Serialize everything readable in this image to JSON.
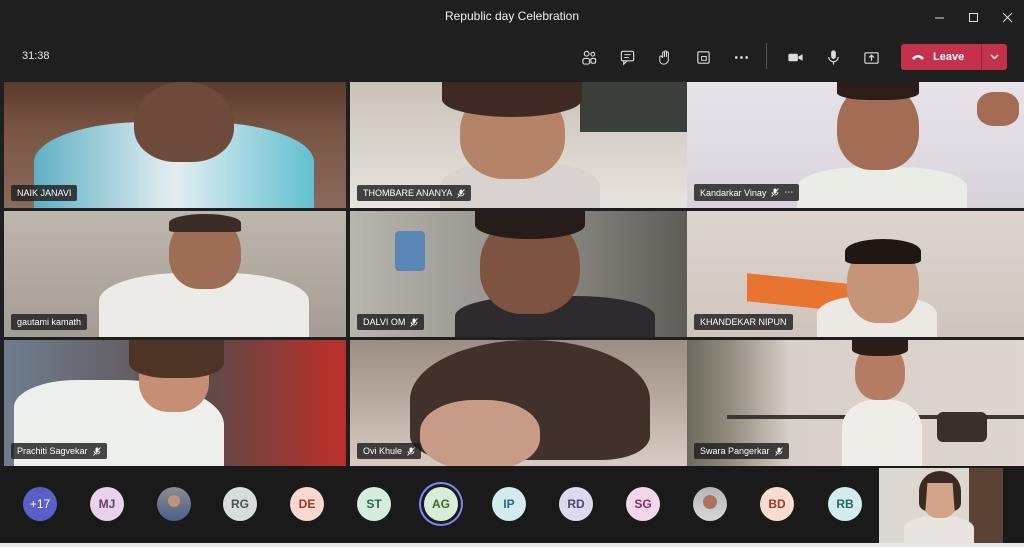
{
  "window": {
    "title": "Republic day Celebration"
  },
  "toolbar": {
    "timer": "31:38",
    "leave_label": "Leave"
  },
  "tiles": [
    {
      "name": "NAIK JANAVI",
      "muted": false,
      "more": false
    },
    {
      "name": "THOMBARE ANANYA",
      "muted": true,
      "more": false
    },
    {
      "name": "Kandarkar Vinay",
      "muted": true,
      "more": true
    },
    {
      "name": "gautami kamath",
      "muted": false,
      "more": false
    },
    {
      "name": "DALVI OM",
      "muted": true,
      "more": false
    },
    {
      "name": "KHANDEKAR NIPUN",
      "muted": false,
      "more": false
    },
    {
      "name": "Prachiti Sagvekar",
      "muted": true,
      "more": false
    },
    {
      "name": "Ovi Khule",
      "muted": true,
      "more": false
    },
    {
      "name": "Swara Pangerkar",
      "muted": true,
      "more": false
    }
  ],
  "tray": {
    "overflow": "+17",
    "avatars": [
      "MJ",
      "RG",
      "DE",
      "ST",
      "AG",
      "IP",
      "RD",
      "SG",
      "BD",
      "RB"
    ]
  },
  "colors": {
    "leave": "#c4314b",
    "overflow": "#5b5fc7",
    "active_ring": "#7f85f5"
  }
}
